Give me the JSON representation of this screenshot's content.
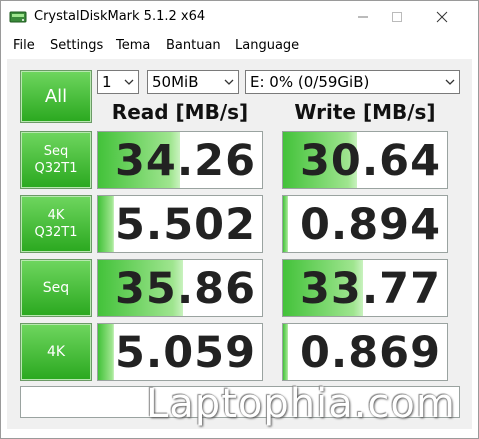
{
  "window": {
    "title": "CrystalDiskMark 5.1.2 x64",
    "controls": {
      "minimize": "—",
      "maximize": "☐",
      "close": "✕"
    }
  },
  "menu": {
    "items": [
      "File",
      "Settings",
      "Tema",
      "Bantuan",
      "Language"
    ]
  },
  "toolbar": {
    "all_label": "All",
    "count_value": "1",
    "size_value": "50MiB",
    "drive_value": "E: 0% (0/59GiB)"
  },
  "headers": {
    "read": "Read [MB/s]",
    "write": "Write [MB/s]"
  },
  "tests": [
    {
      "label_line1": "Seq",
      "label_line2": "Q32T1",
      "read": "34.26",
      "write": "30.64",
      "read_bar": 0.5,
      "write_bar": 0.45
    },
    {
      "label_line1": "4K",
      "label_line2": "Q32T1",
      "read": "5.502",
      "write": "0.894",
      "read_bar": 0.1,
      "write_bar": 0.03
    },
    {
      "label_line1": "Seq",
      "label_line2": "",
      "read": "35.86",
      "write": "33.77",
      "read_bar": 0.52,
      "write_bar": 0.49
    },
    {
      "label_line1": "4K",
      "label_line2": "",
      "read": "5.059",
      "write": "0.869",
      "read_bar": 0.1,
      "write_bar": 0.03
    }
  ],
  "comment": "",
  "watermark": "Laptophia.com",
  "colors": {
    "button_green_top": "#6fd65f",
    "button_green_bottom": "#2aa81f",
    "bar_green": "#43c23a"
  }
}
